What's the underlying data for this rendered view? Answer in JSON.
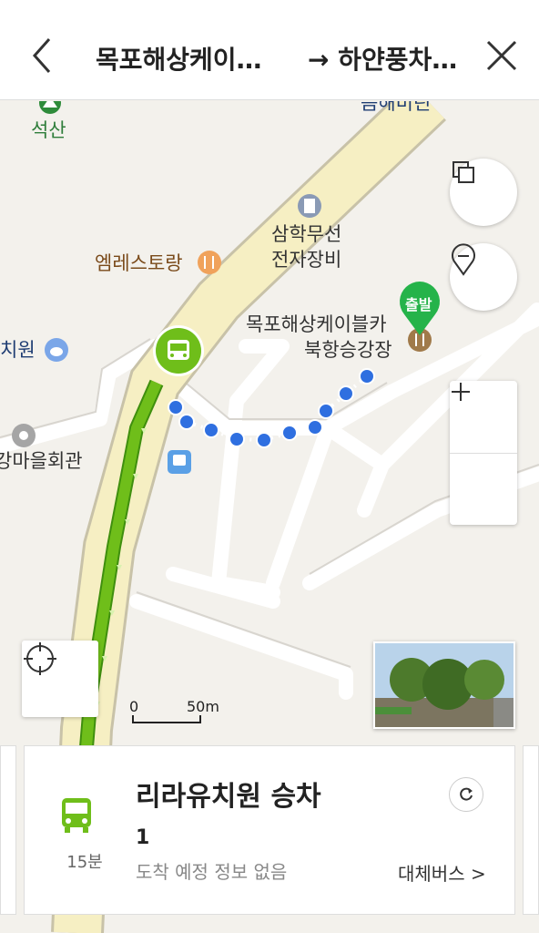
{
  "header": {
    "origin": "목포해상케이…",
    "destination": "→ 하얀풍차…"
  },
  "map": {
    "pois": {
      "top_partial": "음해비린",
      "seoksan": "석산",
      "samhak_line1": "삼학무선",
      "samhak_line2": "전자장비",
      "restaurant": "엠레스토랑",
      "cable_line1": "목포해상케이블카",
      "cable_line2": "북항승강장",
      "kinder_partial": "치원",
      "village_partial": "강마을회관"
    },
    "start_marker_label": "출발",
    "scale": {
      "start": "0",
      "end": "50m"
    },
    "colors": {
      "route_green": "#6fbe1a",
      "walk_blue": "#2f6fe0",
      "marker_green": "#25b34a",
      "road_yellow": "#f6efc3"
    }
  },
  "card": {
    "stop_name": "리라유치원 승차",
    "duration": "15분",
    "route_number": "1",
    "arrival_info": "도착 예정 정보 없음",
    "alternative": "대체버스 >"
  }
}
